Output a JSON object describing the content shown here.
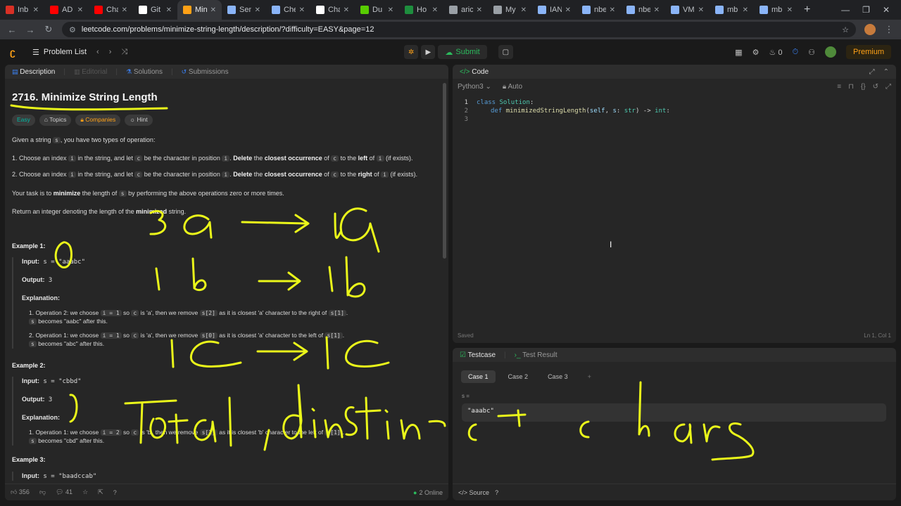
{
  "browser": {
    "tabs": [
      {
        "label": "Inb",
        "color": "#d93025"
      },
      {
        "label": "AD",
        "color": "#ff0000"
      },
      {
        "label": "Cha",
        "color": "#ff0000"
      },
      {
        "label": "Git",
        "color": "#ffffff"
      },
      {
        "label": "Min",
        "color": "#ffa116",
        "active": true
      },
      {
        "label": "Sen",
        "color": "#8ab4f8"
      },
      {
        "label": "Che",
        "color": "#8ab4f8"
      },
      {
        "label": "Cha",
        "color": "#ffffff"
      },
      {
        "label": "Du",
        "color": "#58cc02"
      },
      {
        "label": "Ho",
        "color": "#1e8e3e"
      },
      {
        "label": "aric",
        "color": "#9aa0a6"
      },
      {
        "label": "My",
        "color": "#9aa0a6"
      },
      {
        "label": "IAN",
        "color": "#8ab4f8"
      },
      {
        "label": "nbe",
        "color": "#8ab4f8"
      },
      {
        "label": "nbe",
        "color": "#8ab4f8"
      },
      {
        "label": "VM",
        "color": "#8ab4f8"
      },
      {
        "label": "mb",
        "color": "#8ab4f8"
      },
      {
        "label": "mb",
        "color": "#8ab4f8"
      }
    ],
    "new_tab": "+",
    "url": "leetcode.com/problems/minimize-string-length/description/?difficulty=EASY&page=12"
  },
  "lc": {
    "problem_list": "Problem List",
    "submit": "Submit",
    "streak": "0",
    "premium": "Premium"
  },
  "desc": {
    "tabs": {
      "description": "Description",
      "editorial": "Editorial",
      "solutions": "Solutions",
      "submissions": "Submissions"
    },
    "title": "2716. Minimize String Length",
    "tags": {
      "easy": "Easy",
      "topics": "Topics",
      "companies": "Companies",
      "hint": "Hint"
    },
    "intro_a": "Given a string ",
    "intro_s": "s",
    "intro_b": ", you have two types of operation:",
    "op1": {
      "a": "1. Choose an index ",
      "i1": "i",
      "b": " in the string, and let ",
      "c1": "c",
      "d": " be the character in position ",
      "i2": "i",
      "e": ". ",
      "del": "Delete",
      "f": " the ",
      "closest": "closest occurrence",
      "g": " of ",
      "c2": "c",
      "h": " to the ",
      "dir": "left",
      "j": " of ",
      "i3": "i",
      "k": " (if exists)."
    },
    "op2": {
      "a": "2. Choose an index ",
      "i1": "i",
      "b": " in the string, and let ",
      "c1": "c",
      "d": " be the character in position ",
      "i2": "i",
      "e": ". ",
      "del": "Delete",
      "f": " the ",
      "closest": "closest occurrence",
      "g": " of ",
      "c2": "c",
      "h": " to the ",
      "dir": "right",
      "j": " of ",
      "i3": "i",
      "k": " (if exists)."
    },
    "task": {
      "a": "Your task is to ",
      "b": "minimize",
      "c": " the length of ",
      "s": "s",
      "d": " by performing the above operations zero or more times."
    },
    "ret": {
      "a": "Return an integer denoting the length of the ",
      "b": "minimized",
      "c": " string."
    },
    "ex1": {
      "title": "Example 1:",
      "input_lbl": "Input:",
      "input": " s = \"aaabc\"",
      "output_lbl": "Output:",
      "output": " 3",
      "expl_lbl": "Explanation:",
      "s1a": "1. Operation 2: we choose ",
      "s1c1": "i = 1",
      "s1b": " so ",
      "s1c2": "c",
      "s1d": " is 'a', then we remove ",
      "s1c3": "s[2]",
      "s1e": " as it is closest 'a' character to the right of ",
      "s1c4": "s[1]",
      "s1f": ".",
      "s1g": "s",
      "s1h": " becomes \"aabc\" after this.",
      "s2a": "2. Operation 1: we choose ",
      "s2c1": "i = 1",
      "s2b": " so ",
      "s2c2": "c",
      "s2d": " is 'a', then we remove ",
      "s2c3": "s[0]",
      "s2e": " as it is closest 'a' character to the left of ",
      "s2c4": "s[1]",
      "s2f": ".",
      "s2g": "s",
      "s2h": " becomes \"abc\" after this."
    },
    "ex2": {
      "title": "Example 2:",
      "input_lbl": "Input:",
      "input": " s = \"cbbd\"",
      "output_lbl": "Output:",
      "output": " 3",
      "expl_lbl": "Explanation:",
      "s1a": "1. Operation 1: we choose ",
      "s1c1": "i = 2",
      "s1b": " so ",
      "s1c2": "c",
      "s1d": " is 'b', then we remove ",
      "s1c3": "s[1]",
      "s1e": " as it is closest 'b' character to the left of ",
      "s1c4": "s[1]",
      "s1f": ".",
      "s1g": "s",
      "s1h": " becomes \"cbd\" after this."
    },
    "ex3": {
      "title": "Example 3:",
      "input_lbl": "Input:",
      "input": " s = \"baadccab\""
    },
    "footer": {
      "likes": "356",
      "comments": "41",
      "online": "2 Online"
    }
  },
  "code": {
    "tab": "Code",
    "language": "Python3",
    "auto": "Auto",
    "lines": [
      "1",
      "2",
      "3"
    ],
    "line1_kw": "class",
    "line1_name": "Solution",
    "line1_end": ":",
    "line2_kw": "def",
    "line2_fn": "minimizedStringLength",
    "line2_open": "(",
    "line2_self": "self",
    "line2_mid": ", ",
    "line2_s": "s",
    "line2_colon": ": ",
    "line2_str": "str",
    "line2_arrow": ") -> ",
    "line2_int": "int",
    "line2_end": ":",
    "saved": "Saved",
    "cursor": "Ln 1, Col 1"
  },
  "test": {
    "tab_testcase": "Testcase",
    "tab_result": "Test Result",
    "cases": [
      "Case 1",
      "Case 2",
      "Case 3"
    ],
    "add": "+",
    "var": "s =",
    "value": "\"aaabc\"",
    "source": "Source"
  },
  "colors": {
    "ink": "#eaf71a",
    "accent": "#ffa116",
    "submit": "#2cbb5d"
  }
}
